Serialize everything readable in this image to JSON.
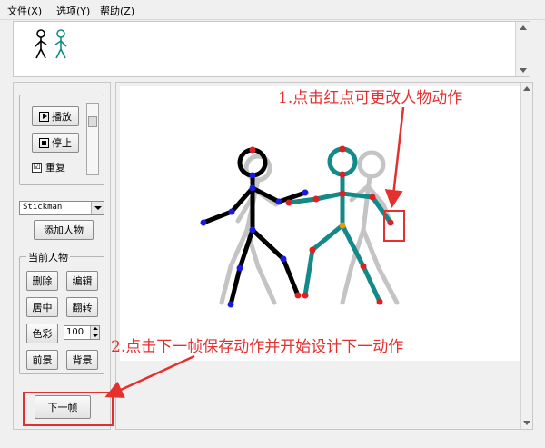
{
  "menu": {
    "file": "文件(X)",
    "options": "选项(Y)",
    "help": "帮助(Z)"
  },
  "playback": {
    "play_label": "播放",
    "stop_label": "停止",
    "repeat_label": "重复",
    "repeat_checked": "☑"
  },
  "figure_select": {
    "value": "Stickman"
  },
  "add_figure_label": "添加人物",
  "current_figure": {
    "title": "当前人物",
    "delete_label": "删除",
    "edit_label": "编辑",
    "center_label": "居中",
    "flip_label": "翻转",
    "color_label": "色彩",
    "opacity_value": "100",
    "front_label": "前景",
    "back_label": "背景"
  },
  "next_frame_label": "下一帧",
  "annotations": {
    "top": "1.点击红点可更改人物动作",
    "bottom": "2.点击下一帧保存动作并开始设计下一动作"
  },
  "colors": {
    "accent": "#e53030",
    "teal": "#138a8a",
    "ghost": "#c4c4c4",
    "joint_red": "#e02020",
    "joint_blue": "#1a1ae0",
    "joint_orange": "#e59a10"
  }
}
